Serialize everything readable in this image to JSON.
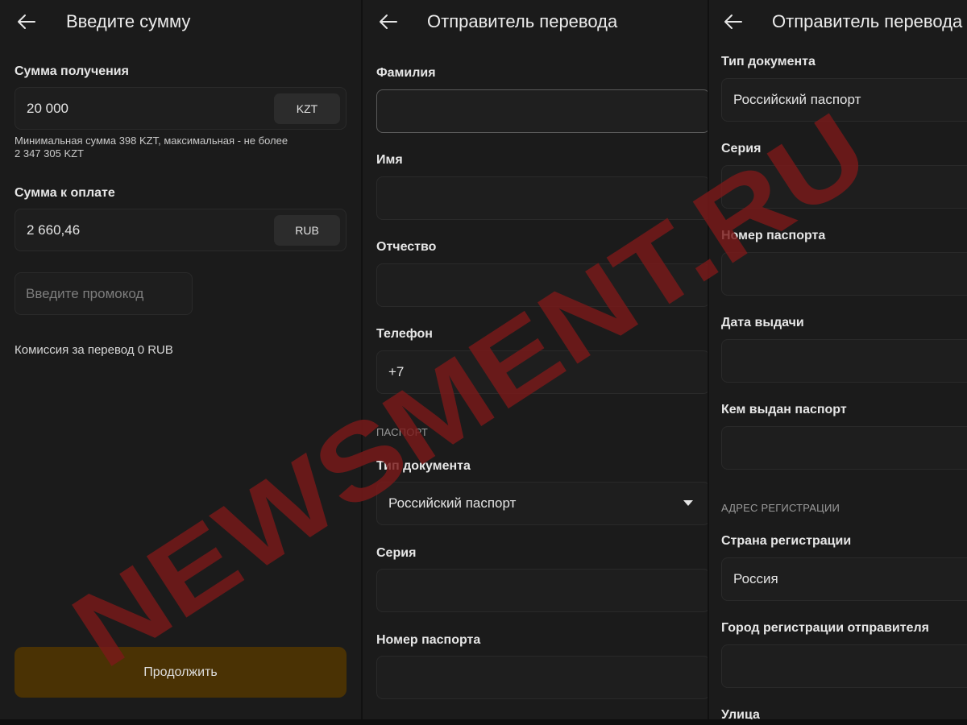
{
  "screen1": {
    "title": "Введите сумму",
    "receive_label": "Сумма получения",
    "receive_value": "20 000",
    "receive_currency": "KZT",
    "limits_line1": "Минимальная сумма 398 KZT, максимальная - не более",
    "limits_line2": "2 347 305 KZT",
    "pay_label": "Сумма к оплате",
    "pay_value": "2 660,46",
    "pay_currency": "RUB",
    "promo_placeholder": "Введите промокод",
    "commission": "Комиссия за перевод 0 RUB",
    "continue_label": "Продолжить"
  },
  "screen2": {
    "title": "Отправитель перевода",
    "surname_label": "Фамилия",
    "name_label": "Имя",
    "patronymic_label": "Отчество",
    "phone_label": "Телефон",
    "phone_value": "+7",
    "passport_section": "ПАСПОРТ",
    "doc_type_label": "Тип документа",
    "doc_type_value": "Российский паспорт",
    "series_label": "Серия",
    "passport_number_label": "Номер паспорта"
  },
  "screen3": {
    "title": "Отправитель перевода",
    "doc_type_label": "Тип документа",
    "doc_type_value": "Российский паспорт",
    "series_label": "Серия",
    "passport_number_label": "Номер паспорта",
    "issue_date_label": "Дата выдачи",
    "issued_by_label": "Кем выдан паспорт",
    "address_section": "АДРЕС РЕГИСТРАЦИИ",
    "country_label": "Страна регистрации",
    "country_value": "Россия",
    "city_label": "Город регистрации отправителя",
    "street_label": "Улица"
  },
  "watermark": {
    "text": "NEWSMENT.RU",
    "color": "#7a1a1a"
  },
  "colors": {
    "background": "#1b1b1b",
    "field": "#1e1e1e",
    "continue_button": "#4a3204"
  },
  "icons": [
    "back-arrow-icon",
    "dropdown-caret-icon"
  ]
}
